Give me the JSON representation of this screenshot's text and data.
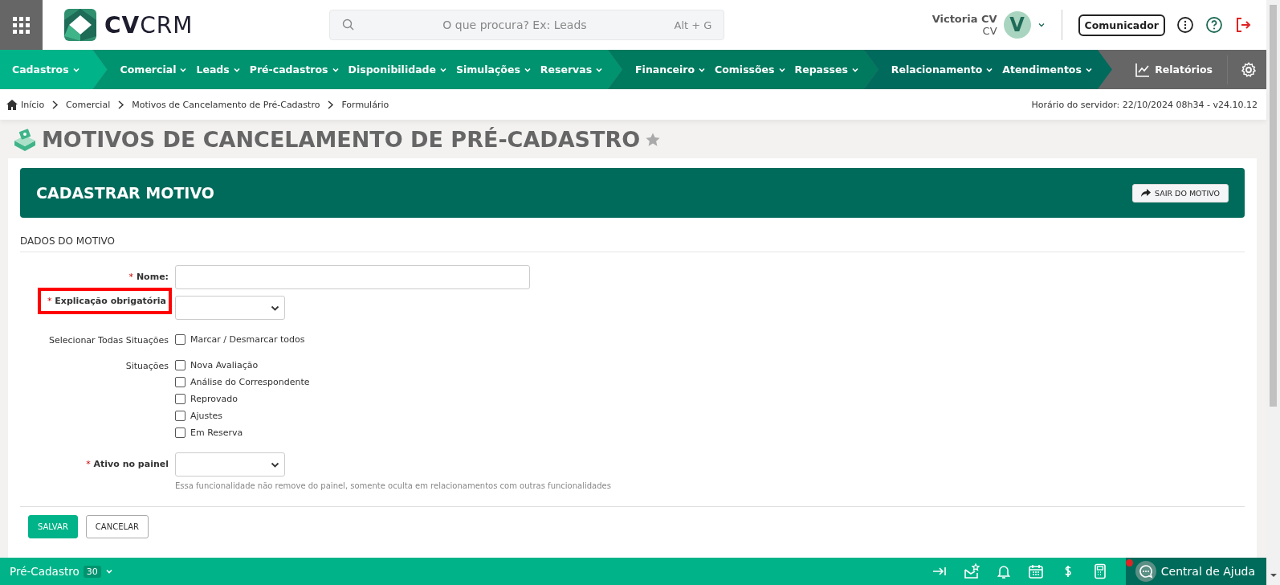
{
  "header": {
    "logo_text": {
      "bold": "CV",
      "light": "CRM"
    },
    "search": {
      "placeholder": "O que procura? Ex: Leads",
      "shortcut": "Alt + G"
    },
    "user": {
      "name": "Victoria CV",
      "company": "CV",
      "initial": "V"
    },
    "communicator_button": "Comunicador"
  },
  "nav": {
    "groups": [
      {
        "items": [
          {
            "label": "Cadastros"
          }
        ]
      },
      {
        "items": [
          {
            "label": "Comercial"
          },
          {
            "label": "Leads"
          },
          {
            "label": "Pré-cadastros"
          },
          {
            "label": "Disponibilidade"
          },
          {
            "label": "Simulações"
          },
          {
            "label": "Reservas"
          }
        ]
      },
      {
        "items": [
          {
            "label": "Financeiro"
          },
          {
            "label": "Comissões"
          },
          {
            "label": "Repasses"
          }
        ]
      },
      {
        "items": [
          {
            "label": "Relacionamento"
          },
          {
            "label": "Atendimentos"
          }
        ]
      }
    ],
    "reports": "Relatórios"
  },
  "breadcrumb": [
    "Início",
    "Comercial",
    "Motivos de Cancelamento de Pré-Cadastro",
    "Formulário"
  ],
  "server_time": "Horário do servidor: 22/10/2024 08h34 - v24.10.12",
  "page_title": "MOTIVOS DE CANCELAMENTO DE PRÉ-CADASTRO",
  "favorite": false,
  "panel": {
    "title": "CADASTRAR MOTIVO",
    "exit_button": "SAIR DO MOTIVO"
  },
  "section_title": "DADOS DO MOTIVO",
  "fields": [
    {
      "kind": "text",
      "marker": "*",
      "label": "Nome:",
      "highlighted": false
    },
    {
      "kind": "select",
      "marker": "*",
      "label": "Explicação obrigatória",
      "highlighted": true
    },
    {
      "kind": "checkboxes",
      "label": "Selecionar Todas Situações",
      "highlighted": false,
      "options": [
        {
          "label": "Marcar / Desmarcar todos",
          "checked": false
        }
      ]
    },
    {
      "kind": "checkboxes",
      "label": "Situações",
      "highlighted": false,
      "options": [
        {
          "label": "Nova Avaliação",
          "checked": false
        },
        {
          "label": "Análise do Correspondente",
          "checked": false
        },
        {
          "label": "Reprovado",
          "checked": false
        },
        {
          "label": "Ajustes",
          "checked": false
        },
        {
          "label": "Em Reserva",
          "checked": false
        }
      ]
    },
    {
      "kind": "select",
      "marker": "*",
      "label": "Ativo no painel",
      "highlighted": false,
      "help": "Essa funcionalidade não remove do painel, somente oculta em relacionamentos com outras funcionalidades"
    }
  ],
  "buttons": [
    {
      "label": "SALVAR",
      "kind": "primary"
    },
    {
      "label": "CANCELAR",
      "kind": "secondary"
    }
  ],
  "bottom_bar": {
    "module": "Pré-Cadastro",
    "count": "30",
    "help": "Central de Ajuda",
    "help_notification": true
  }
}
